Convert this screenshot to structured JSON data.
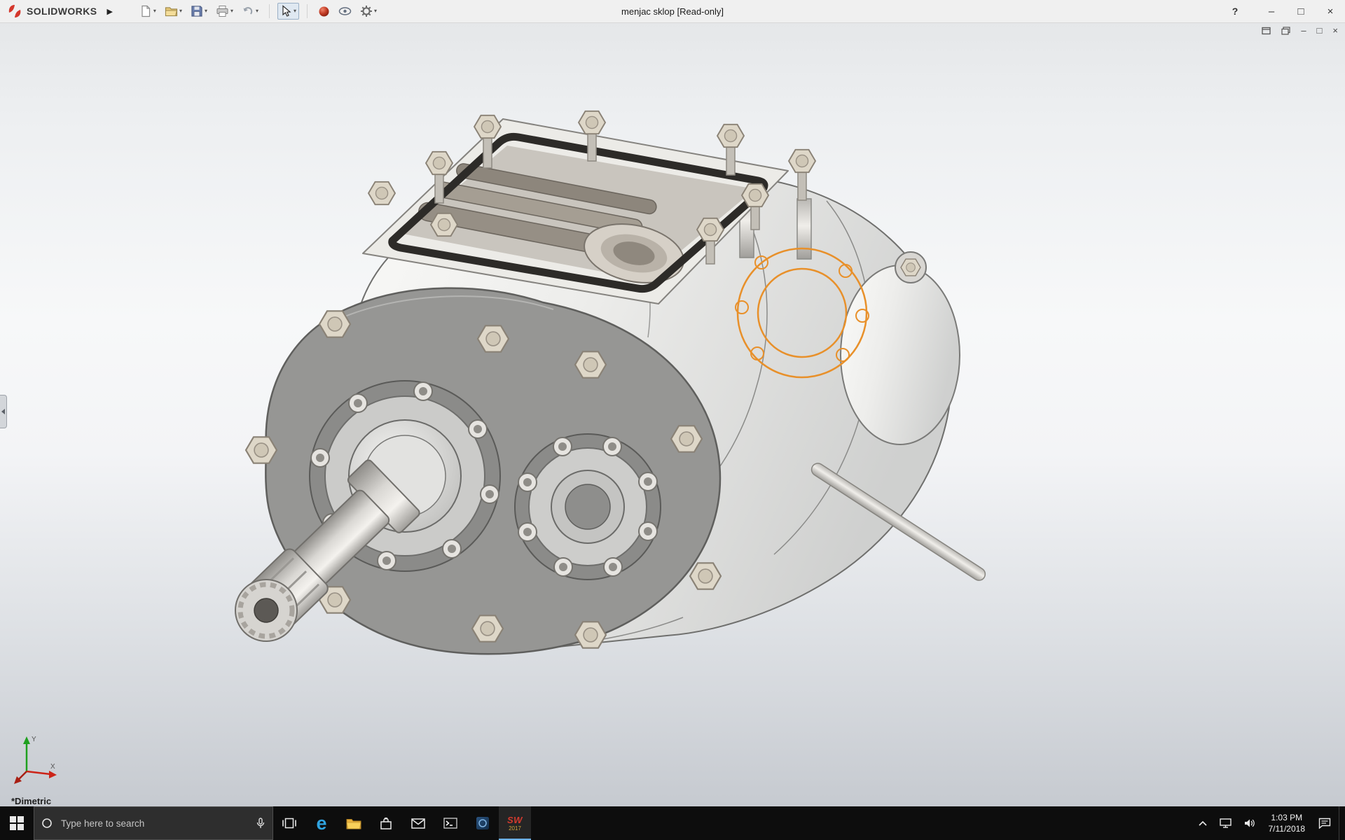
{
  "colors": {
    "selection_highlight": "#E8902A",
    "sw_brand_red": "#D4372C",
    "edge_blue": "#2FA3E0",
    "folder_yellow": "#F5C542",
    "taskbar_bg": "#0D0D0D"
  },
  "titlebar": {
    "brand": "SOLIDWORKS",
    "flyout_arrow": "▶",
    "document_title": "menjac sklop [Read-only]",
    "help_glyph": "?",
    "minimize_glyph": "–",
    "maximize_glyph": "□",
    "close_glyph": "×",
    "dropdown_caret": "▾",
    "toolbar_icons": [
      "new-document",
      "open",
      "save",
      "print",
      "undo",
      "select-cursor",
      "appearances",
      "display-settings",
      "options"
    ]
  },
  "viewport": {
    "view_label": "*Dimetric",
    "triad": {
      "x_label": "X",
      "y_label": "Y"
    },
    "doc_controls": {
      "minimize_glyph": "–",
      "restore_glyph": "□",
      "close_glyph": "×"
    }
  },
  "taskbar": {
    "search_placeholder": "Type here to search",
    "icons": [
      "start",
      "search",
      "microphone",
      "task-view",
      "edge",
      "file-explorer",
      "store",
      "mail",
      "console",
      "dark-blue-app",
      "solidworks-2017"
    ],
    "edge_glyph": "e",
    "solidworks_app": {
      "label": "SW",
      "year": "2017"
    },
    "clock": {
      "time": "1:03 PM",
      "date": "7/11/2018"
    }
  }
}
